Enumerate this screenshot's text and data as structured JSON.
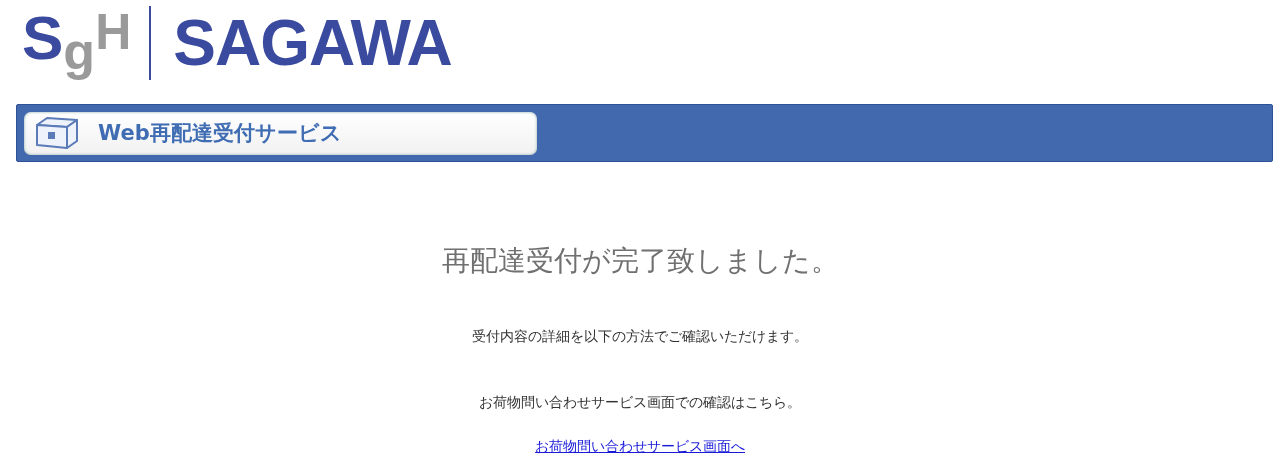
{
  "logo": {
    "mark": [
      "S",
      "g",
      "H"
    ],
    "wordmark": "SAGAWA"
  },
  "banner": {
    "title": "Web再配達受付サービス"
  },
  "message": {
    "heading": "再配達受付が完了致しました。",
    "lines": [
      "受付内容の詳細を以下の方法でご確認いただけます。",
      "お荷物問い合わせサービス画面での確認はこちら。"
    ],
    "link": "お荷物問い合わせサービス画面へ"
  }
}
